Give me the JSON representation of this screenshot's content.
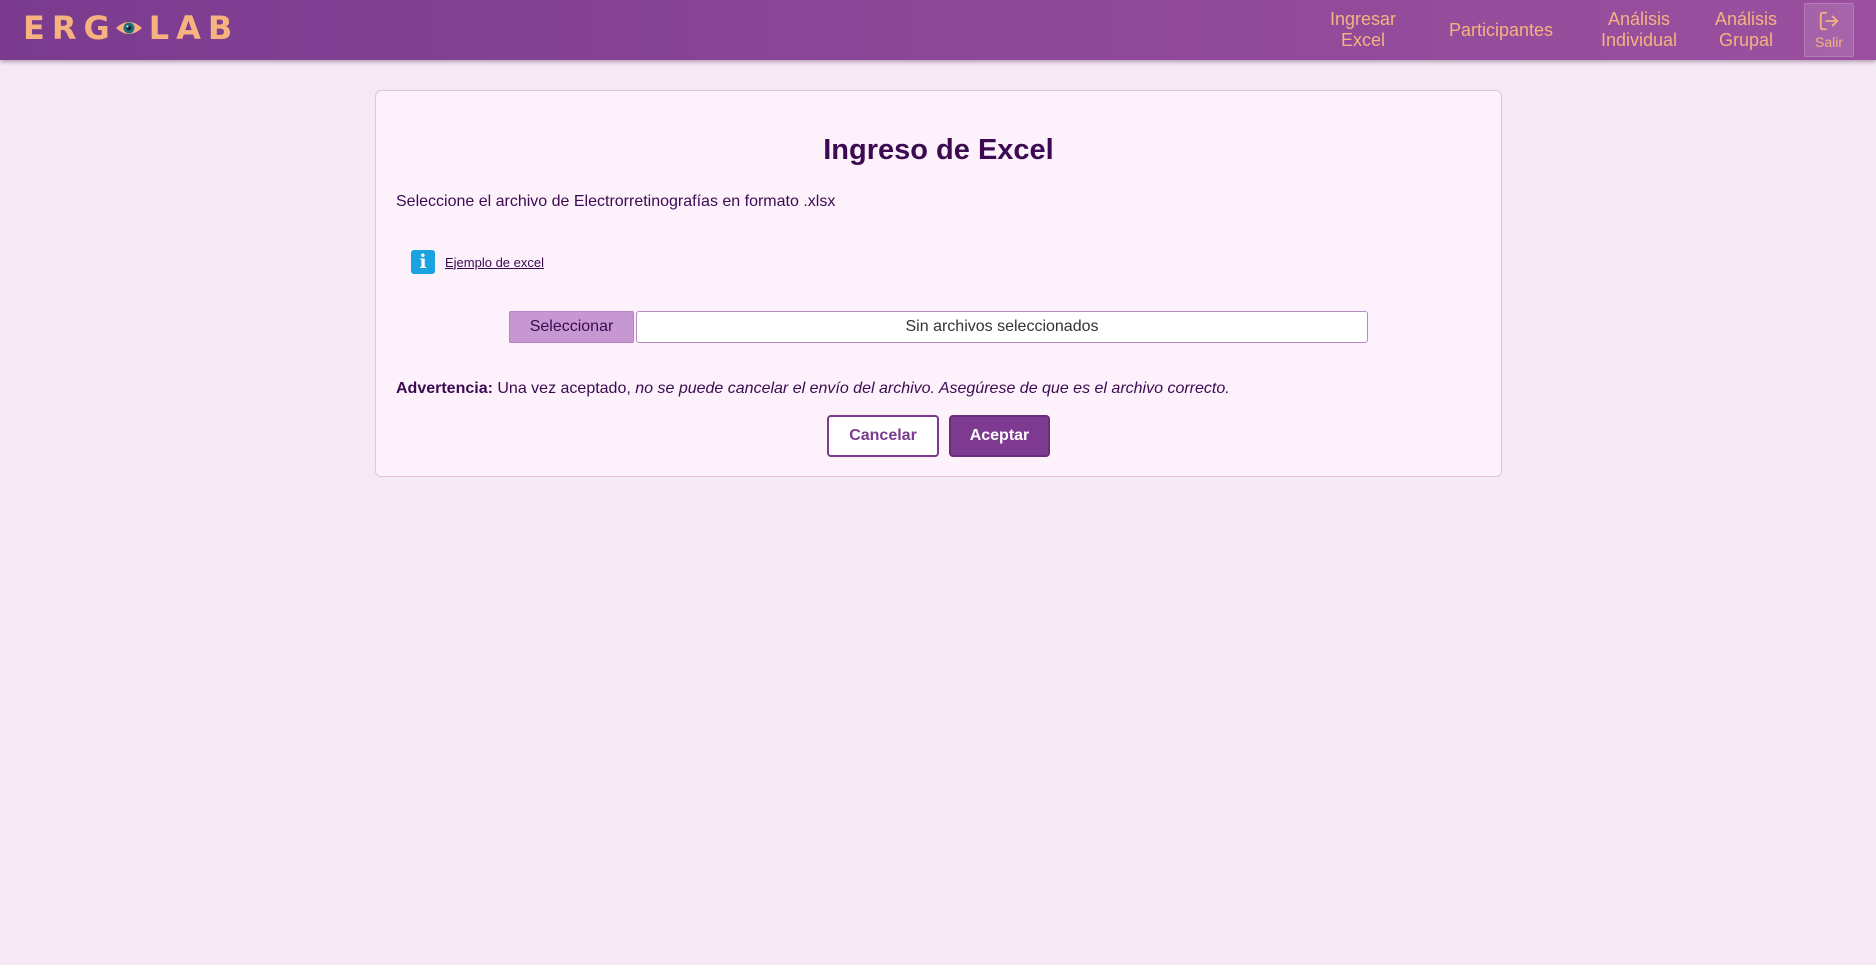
{
  "app": {
    "logo_left": "ERG",
    "logo_right": "LAB"
  },
  "nav": {
    "items": [
      {
        "label": "Ingresar\nExcel"
      },
      {
        "label": "Participantes"
      },
      {
        "label": "Análisis\nIndividual"
      },
      {
        "label": "Análisis\nGrupal"
      }
    ],
    "exit_label": "Salir",
    "exit_icon": "logout-icon"
  },
  "card": {
    "title": "Ingreso de Excel",
    "instructions": "Seleccione el archivo de Electrorretinografías en formato .xlsx",
    "example_link": "Ejemplo de excel",
    "info_icon": "info-icon",
    "select_button": "Seleccionar",
    "file_status": "Sin archivos seleccionados",
    "warning_label": "Advertencia:",
    "warning_plain": "Una vez aceptado,",
    "warning_italic": "no se puede cancelar el envío del archivo. Asegúrese de que es el archivo correcto.",
    "cancel_button": "Cancelar",
    "accept_button": "Aceptar"
  },
  "colors": {
    "topbar": "#8c4797",
    "accent_text": "#f6b27f",
    "primary": "#7d3a90",
    "select_button": "#c697d1",
    "info_icon": "#1aa3e0",
    "background": "#f5eaf4"
  }
}
